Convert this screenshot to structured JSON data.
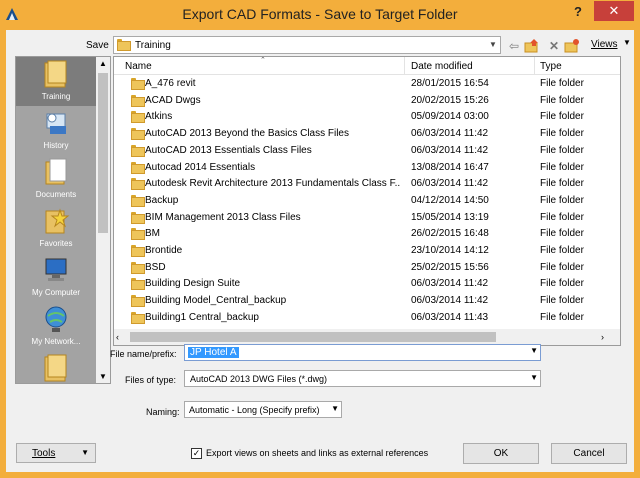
{
  "window": {
    "title": "Export CAD Formats - Save to Target Folder",
    "help_label": "?",
    "close_label": "✕"
  },
  "save": {
    "label": "Save",
    "folder": "Training"
  },
  "toolbar": {
    "views_label": "Views"
  },
  "places": [
    {
      "label": "Training",
      "icon": "folder-icon",
      "selected": true
    },
    {
      "label": "History",
      "icon": "history-icon"
    },
    {
      "label": "Documents",
      "icon": "documents-icon"
    },
    {
      "label": "Favorites",
      "icon": "favorites-icon"
    },
    {
      "label": "My Computer",
      "icon": "computer-icon"
    },
    {
      "label": "My Network...",
      "icon": "network-icon"
    },
    {
      "label": "",
      "icon": "folder-icon"
    }
  ],
  "columns": {
    "name": "Name",
    "date": "Date modified",
    "type": "Type"
  },
  "files": [
    {
      "name": "A_476 revit",
      "date": "28/01/2015 16:54",
      "type": "File folder"
    },
    {
      "name": "ACAD Dwgs",
      "date": "20/02/2015 15:26",
      "type": "File folder"
    },
    {
      "name": "Atkins",
      "date": "05/09/2014 03:00",
      "type": "File folder"
    },
    {
      "name": "AutoCAD 2013 Beyond the Basics Class Files",
      "date": "06/03/2014 11:42",
      "type": "File folder"
    },
    {
      "name": "AutoCAD 2013 Essentials Class Files",
      "date": "06/03/2014 11:42",
      "type": "File folder"
    },
    {
      "name": "Autocad 2014 Essentials",
      "date": "13/08/2014 16:47",
      "type": "File folder"
    },
    {
      "name": "Autodesk Revit Architecture 2013 Fundamentals Class F...",
      "date": "06/03/2014 11:42",
      "type": "File folder"
    },
    {
      "name": "Backup",
      "date": "04/12/2014 14:50",
      "type": "File folder"
    },
    {
      "name": "BIM Management 2013 Class Files",
      "date": "15/05/2014 13:19",
      "type": "File folder"
    },
    {
      "name": "BM",
      "date": "26/02/2015 16:48",
      "type": "File folder"
    },
    {
      "name": "Brontide",
      "date": "23/10/2014 14:12",
      "type": "File folder"
    },
    {
      "name": "BSD",
      "date": "25/02/2015 15:56",
      "type": "File folder"
    },
    {
      "name": "Building Design Suite",
      "date": "06/03/2014 11:42",
      "type": "File folder"
    },
    {
      "name": "Building Model_Central_backup",
      "date": "06/03/2014 11:42",
      "type": "File folder"
    },
    {
      "name": "Building1 Central_backup",
      "date": "06/03/2014 11:43",
      "type": "File folder"
    }
  ],
  "file_name": {
    "label": "File name/prefix:",
    "value": "JP Hotel A"
  },
  "file_type": {
    "label": "Files of type:",
    "value": "AutoCAD 2013 DWG Files  (*.dwg)"
  },
  "naming": {
    "label": "Naming:",
    "value": "Automatic - Long (Specify prefix)"
  },
  "buttons": {
    "tools": "Tools",
    "ok": "OK",
    "cancel": "Cancel"
  },
  "export_option": {
    "label": "Export views on sheets and links as external references",
    "checked": true
  },
  "colors": {
    "title_bar": "#f3ae3c",
    "close": "#c7403a",
    "places_panel": "#a3a3a3",
    "selection": "#3399ff"
  }
}
